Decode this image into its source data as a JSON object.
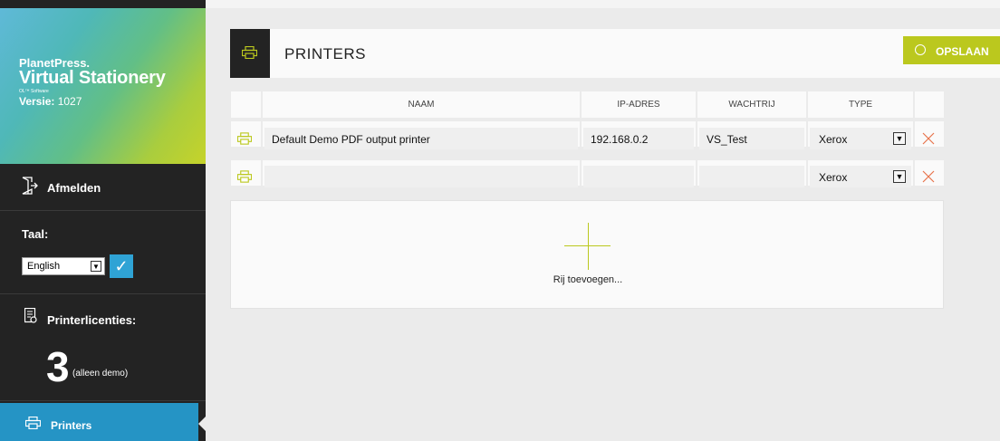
{
  "brand": {
    "product_line": "PlanetPress.",
    "product_name": "Virtual Stationery",
    "vendor": "OL™ Software",
    "version_label": "Versie:",
    "version_value": " 1027"
  },
  "sidebar": {
    "logout_label": "Afmelden",
    "language_label": "Taal:",
    "language_value": "English",
    "licenses_label": "Printerlicenties:",
    "licenses_count": "3",
    "licenses_note": "(alleen demo)",
    "printers_label": "Printers"
  },
  "header": {
    "title": "PRINTERS",
    "save_label": "OPSLAAN"
  },
  "table": {
    "columns": [
      "NAAM",
      "IP-ADRES",
      "WACHTRIJ",
      "TYPE"
    ],
    "rows": [
      {
        "name": "Default Demo PDF output printer",
        "ip": "192.168.0.2",
        "queue": "VS_Test",
        "type": "Xerox"
      },
      {
        "name": "",
        "ip": "",
        "queue": "",
        "type": "Xerox"
      }
    ],
    "add_row_label": "Rij toevoegen..."
  },
  "colors": {
    "accent_green": "#bbc81e",
    "accent_blue": "#2594c5",
    "sidebar_bg": "#232323",
    "delete_red": "#e8734a"
  },
  "icons": [
    "logout-icon",
    "license-icon",
    "printer-icon",
    "refresh-icon",
    "delete-icon",
    "chevron-down-icon",
    "checkmark-icon",
    "plus-icon"
  ]
}
